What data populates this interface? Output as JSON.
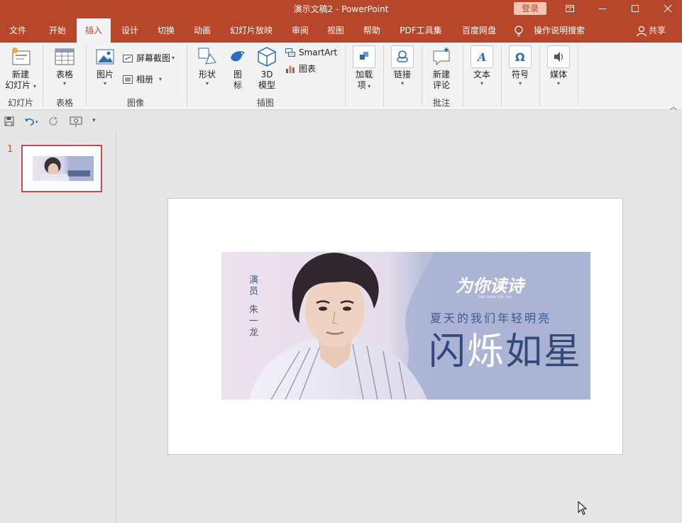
{
  "window": {
    "title": "演示文稿2  -  PowerPoint",
    "login_label": "登录"
  },
  "tabs": [
    {
      "label": "文件",
      "active": false
    },
    {
      "label": "开始",
      "active": false
    },
    {
      "label": "插入",
      "active": true
    },
    {
      "label": "设计",
      "active": false
    },
    {
      "label": "切换",
      "active": false
    },
    {
      "label": "动画",
      "active": false
    },
    {
      "label": "幻灯片放映",
      "active": false
    },
    {
      "label": "审阅",
      "active": false
    },
    {
      "label": "视图",
      "active": false
    },
    {
      "label": "帮助",
      "active": false
    },
    {
      "label": "PDF工具集",
      "active": false
    },
    {
      "label": "百度网盘",
      "active": false
    }
  ],
  "tell_me": "操作说明搜索",
  "share_label": "共享",
  "ribbon": {
    "slides": {
      "new_slide_line1": "新建",
      "new_slide_line2": "幻灯片",
      "group": "幻灯片"
    },
    "tables": {
      "table": "表格",
      "group": "表格"
    },
    "images": {
      "pictures": "图片",
      "screenshot": "屏幕截图",
      "album": "相册",
      "group": "图像"
    },
    "illustrations": {
      "shapes": "形状",
      "icons_line1": "图",
      "icons_line2": "标",
      "model_line1": "3D",
      "model_line2": "模型",
      "smartart": "SmartArt",
      "chart": "图表",
      "group": "插图"
    },
    "addins": {
      "line1": "加载",
      "line2": "项"
    },
    "links": {
      "label": "链接"
    },
    "comments": {
      "line1": "新建",
      "line2": "评论",
      "group": "批注"
    },
    "text": {
      "label": "文本"
    },
    "symbols": {
      "label": "符号"
    },
    "media": {
      "label": "媒体"
    }
  },
  "slides_pane": {
    "slide_number": "1"
  },
  "banner": {
    "role": "演员",
    "name": "朱一龙",
    "script_title": "为你读诗",
    "script_sub": "THE POEM FOR YOU",
    "line": "夏天的我们年轻明亮",
    "big_a": "闪",
    "big_b": "烁",
    "big_c": "如星",
    "colors": {
      "bg_left": "#ede3ee",
      "bg_right": "#aab3d3",
      "text_blue": "#3f5a88"
    }
  },
  "colors": {
    "accent": "#b7472a",
    "ribbon_bg": "#f3f3f3",
    "canvas_bg": "#e6e6e6"
  }
}
